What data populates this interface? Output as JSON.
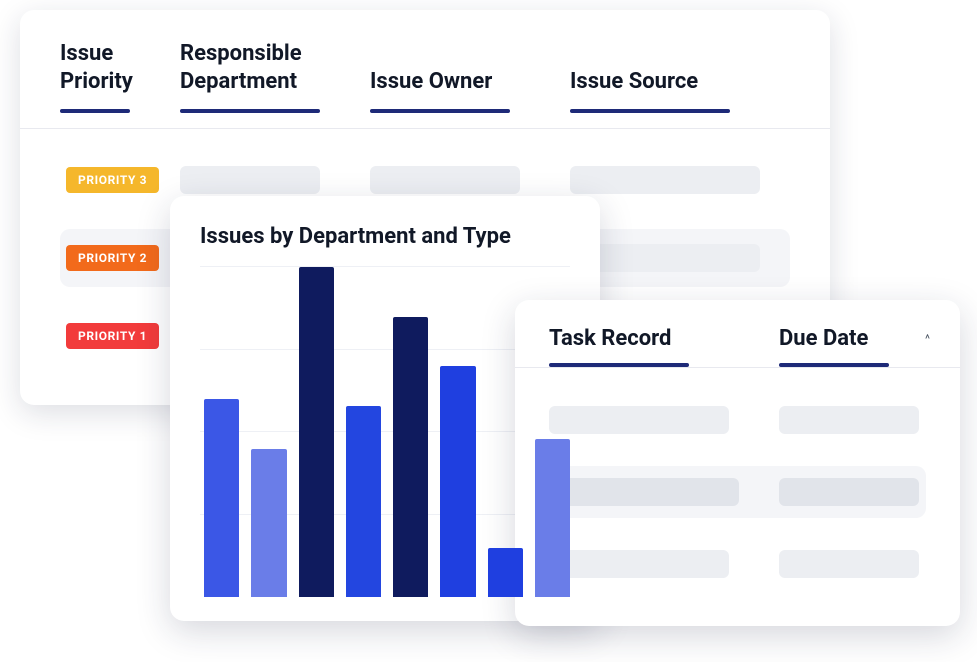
{
  "issues_table": {
    "columns": {
      "priority": "Issue Priority",
      "department": "Responsible Department",
      "owner": "Issue Owner",
      "source": "Issue Source"
    },
    "rows": [
      {
        "priority_label": "PRIORITY 3",
        "priority_color": "#f5b72b",
        "highlight": false
      },
      {
        "priority_label": "PRIORITY 2",
        "priority_color": "#f26a1b",
        "highlight": true
      },
      {
        "priority_label": "PRIORITY 1",
        "priority_color": "#f23b3b",
        "highlight": false
      }
    ]
  },
  "chart_data": {
    "type": "bar",
    "title": "Issues by Department and Type",
    "series": [
      {
        "value": 60,
        "color": "#3b57e6"
      },
      {
        "value": 45,
        "color": "#6a7de8"
      },
      {
        "value": 100,
        "color": "#0f1b5e"
      },
      {
        "value": 58,
        "color": "#2346e0"
      },
      {
        "value": 85,
        "color": "#0f1b5e"
      },
      {
        "value": 70,
        "color": "#1f3fe0"
      },
      {
        "value": 15,
        "color": "#1f3fe0"
      },
      {
        "value": 48,
        "color": "#6a7de8"
      }
    ],
    "ylim": [
      0,
      100
    ],
    "gridlines": 4
  },
  "task_table": {
    "columns": {
      "record": "Task Record",
      "due": "Due Date"
    },
    "sort_icon": "^",
    "rows": [
      {
        "highlight": false
      },
      {
        "highlight": true
      },
      {
        "highlight": false
      }
    ]
  }
}
